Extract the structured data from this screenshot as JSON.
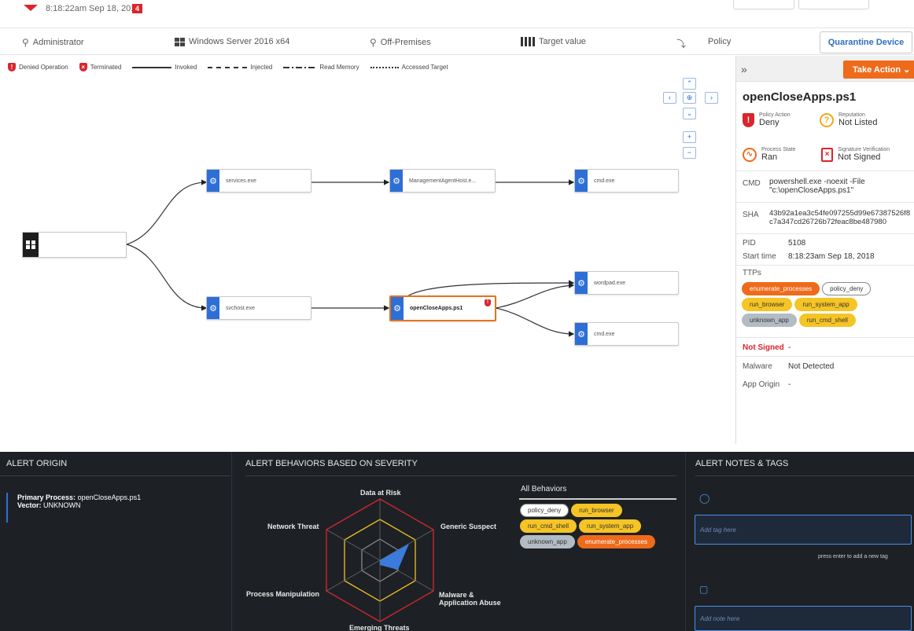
{
  "header": {
    "timestamp": "8:18:22am Sep 18, 2018",
    "count": "4"
  },
  "info": {
    "user": "Administrator",
    "os": "Windows Server 2016 x64",
    "location": "Off-Premises",
    "target": "Target value",
    "policy": "Policy",
    "quarantine": "Quarantine Device"
  },
  "legend": {
    "denied": "Denied Operation",
    "terminated": "Terminated",
    "invoked": "Invoked",
    "injected": "Injected",
    "read_memory": "Read Memory",
    "accessed": "Accessed Target"
  },
  "graph": {
    "nodes": {
      "services": "services.exe",
      "mah": "ManagementAgentHost.e...",
      "cmd1": "cmd.exe",
      "svchost": "svchost.exe",
      "opencloseapps": "openCloseApps.ps1",
      "wordpad": "wordpad.exe",
      "cmd2": "cmd.exe"
    }
  },
  "panel": {
    "take_action": "Take Action",
    "title": "openCloseApps.ps1",
    "policy_action_k": "Policy Action",
    "policy_action_v": "Deny",
    "reputation_k": "Reputation",
    "reputation_v": "Not Listed",
    "process_state_k": "Process State",
    "process_state_v": "Ran",
    "sig_k": "Signature Verification",
    "sig_v": "Not Signed",
    "cmd_k": "CMD",
    "cmd_v1": "powershell.exe -noexit -File",
    "cmd_v2": "\"c:\\openCloseApps.ps1\"",
    "sha_k": "SHA",
    "sha_v1": "43b92a1ea3c54fe097255d99e67387526f8",
    "sha_v2": "c7a347cd26726b72feac8be487980",
    "pid_k": "PID",
    "pid_v": "5108",
    "start_k": "Start time",
    "start_v": "8:18:23am Sep 18, 2018",
    "ttps_k": "TTPs",
    "ttps": [
      "enumerate_processes",
      "policy_deny",
      "run_browser",
      "run_system_app",
      "unknown_app",
      "run_cmd_shell"
    ],
    "not_signed": "Not Signed",
    "not_signed_v": "-",
    "malware_k": "Malware",
    "malware_v": "Not Detected",
    "origin_k": "App Origin",
    "origin_v": "-"
  },
  "bottom": {
    "origin_title": "ALERT ORIGIN",
    "primary_k": "Primary Process:",
    "primary_v": "openCloseApps.ps1",
    "vector_k": "Vector:",
    "vector_v": "UNKNOWN",
    "behaviors_title": "ALERT BEHAVIORS BASED ON SEVERITY",
    "radar": {
      "top": "Data at Risk",
      "tr": "Generic Suspect",
      "br1": "Malware &",
      "br2": "Application Abuse",
      "bottom": "Emerging Threats",
      "bl": "Process Manipulation",
      "tl": "Network Threat"
    },
    "all_behaviors": "All Behaviors",
    "behavior_tags": [
      "policy_deny",
      "run_browser",
      "run_cmd_shell",
      "run_system_app",
      "unknown_app",
      "enumerate_processes"
    ],
    "notes_title": "ALERT NOTES & TAGS",
    "tag_placeholder": "Add tag here",
    "tag_hint": "press enter to add a new tag",
    "note_placeholder": "Add note here"
  },
  "colors": {
    "accent_orange": "#ee6b1c",
    "danger_red": "#d9252d",
    "link_blue": "#2f6fbf",
    "node_blue": "#2d6fd6",
    "tag_yellow": "#f5c425",
    "dark_bg": "#1d2125"
  }
}
